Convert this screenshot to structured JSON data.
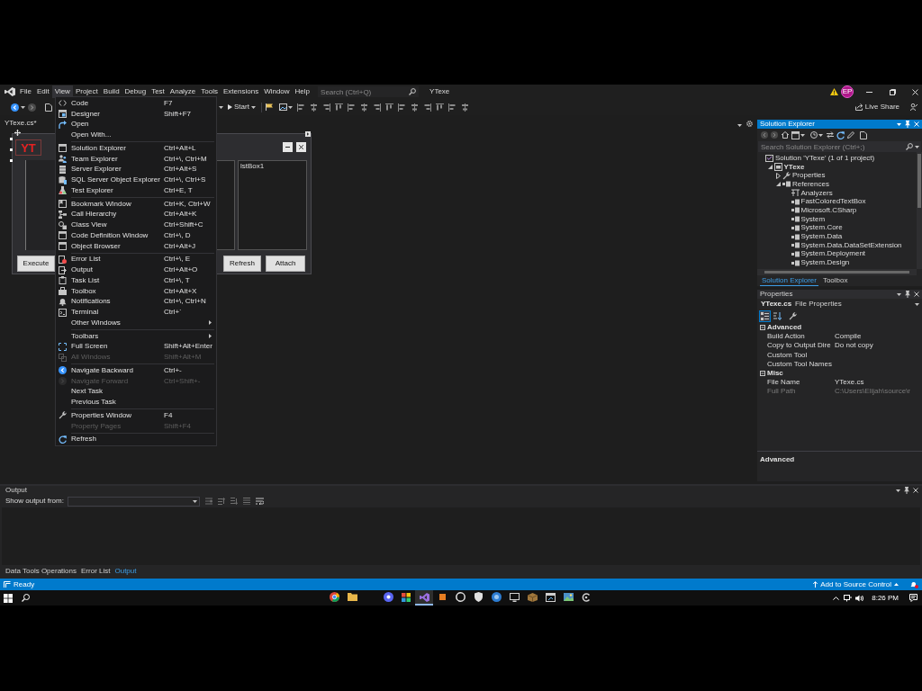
{
  "menubar": {
    "items": [
      {
        "label": "File",
        "selected": false
      },
      {
        "label": "Edit",
        "selected": false
      },
      {
        "label": "View",
        "selected": true
      },
      {
        "label": "Project",
        "selected": false
      },
      {
        "label": "Build",
        "selected": false
      },
      {
        "label": "Debug",
        "selected": false
      },
      {
        "label": "Test",
        "selected": false
      },
      {
        "label": "Analyze",
        "selected": false
      },
      {
        "label": "Tools",
        "selected": false
      },
      {
        "label": "Extensions",
        "selected": false
      },
      {
        "label": "Window",
        "selected": false
      },
      {
        "label": "Help",
        "selected": false
      }
    ],
    "search": {
      "placeholder": "Search (Ctrl+Q)"
    },
    "title": "YTexe",
    "account": "EP"
  },
  "toolbar": {
    "start": "Start",
    "live_share": "Live Share"
  },
  "document_tab": {
    "label": "YTexe.cs*"
  },
  "form_designer": {
    "logo": "YT",
    "listbox": "lstBox1",
    "buttons": [
      "Execute",
      "Refresh",
      "Attach"
    ]
  },
  "view_menu": {
    "groups": [
      [
        {
          "label": "Code",
          "shortcut": "F7",
          "disabled": false
        },
        {
          "label": "Designer",
          "shortcut": "Shift+F7",
          "disabled": false
        },
        {
          "label": "Open",
          "disabled": false
        },
        {
          "label": "Open With...",
          "disabled": false
        }
      ],
      [
        {
          "label": "Solution Explorer",
          "shortcut": "Ctrl+Alt+L",
          "disabled": false
        },
        {
          "label": "Team Explorer",
          "shortcut": "Ctrl+\\, Ctrl+M",
          "disabled": false
        },
        {
          "label": "Server Explorer",
          "shortcut": "Ctrl+Alt+S",
          "disabled": false
        },
        {
          "label": "SQL Server Object Explorer",
          "shortcut": "Ctrl+\\, Ctrl+S",
          "disabled": false
        },
        {
          "label": "Test Explorer",
          "shortcut": "Ctrl+E, T",
          "disabled": false
        }
      ],
      [
        {
          "label": "Bookmark Window",
          "shortcut": "Ctrl+K, Ctrl+W",
          "disabled": false
        },
        {
          "label": "Call Hierarchy",
          "shortcut": "Ctrl+Alt+K",
          "disabled": false
        },
        {
          "label": "Class View",
          "shortcut": "Ctrl+Shift+C",
          "disabled": false
        },
        {
          "label": "Code Definition Window",
          "shortcut": "Ctrl+\\, D",
          "disabled": false
        },
        {
          "label": "Object Browser",
          "shortcut": "Ctrl+Alt+J",
          "disabled": false
        }
      ],
      [
        {
          "label": "Error List",
          "shortcut": "Ctrl+\\, E",
          "disabled": false
        },
        {
          "label": "Output",
          "shortcut": "Ctrl+Alt+O",
          "disabled": false
        },
        {
          "label": "Task List",
          "shortcut": "Ctrl+\\, T",
          "disabled": false
        },
        {
          "label": "Toolbox",
          "shortcut": "Ctrl+Alt+X",
          "disabled": false
        },
        {
          "label": "Notifications",
          "shortcut": "Ctrl+\\, Ctrl+N",
          "disabled": false
        },
        {
          "label": "Terminal",
          "shortcut": "Ctrl+`",
          "disabled": false
        },
        {
          "label": "Other Windows",
          "submenu": true,
          "disabled": false
        }
      ],
      [
        {
          "label": "Toolbars",
          "submenu": true,
          "disabled": false
        },
        {
          "label": "Full Screen",
          "shortcut": "Shift+Alt+Enter",
          "disabled": false
        },
        {
          "label": "All Windows",
          "shortcut": "Shift+Alt+M",
          "disabled": true
        }
      ],
      [
        {
          "label": "Navigate Backward",
          "shortcut": "Ctrl+-",
          "disabled": false
        },
        {
          "label": "Navigate Forward",
          "shortcut": "Ctrl+Shift+-",
          "disabled": true
        },
        {
          "label": "Next Task",
          "disabled": false
        },
        {
          "label": "Previous Task",
          "disabled": false
        }
      ],
      [
        {
          "label": "Properties Window",
          "shortcut": "F4",
          "disabled": false
        },
        {
          "label": "Property Pages",
          "shortcut": "Shift+F4",
          "disabled": true
        }
      ],
      [
        {
          "label": "Refresh",
          "disabled": false
        }
      ]
    ]
  },
  "solution_explorer": {
    "title": "Solution Explorer",
    "search": {
      "placeholder": "Search Solution Explorer (Ctrl+;)"
    },
    "tree": [
      {
        "label": "Solution 'YTexe' (1 of 1 project)",
        "kind": "solution",
        "children": [
          {
            "label": "YTexe",
            "kind": "project",
            "expanded": true,
            "children": [
              {
                "label": "Properties",
                "kind": "properties",
                "expanded": false
              },
              {
                "label": "References",
                "kind": "references",
                "expanded": true,
                "children": [
                  {
                    "label": "Analyzers",
                    "kind": "analyzers"
                  },
                  {
                    "label": "FastColoredTextBox",
                    "kind": "reference"
                  },
                  {
                    "label": "Microsoft.CSharp",
                    "kind": "reference"
                  },
                  {
                    "label": "System",
                    "kind": "reference"
                  },
                  {
                    "label": "System.Core",
                    "kind": "reference"
                  },
                  {
                    "label": "System.Data",
                    "kind": "reference"
                  },
                  {
                    "label": "System.Data.DataSetExtension",
                    "kind": "reference"
                  },
                  {
                    "label": "System.Deployment",
                    "kind": "reference"
                  },
                  {
                    "label": "System.Design",
                    "kind": "reference"
                  }
                ]
              }
            ]
          }
        ]
      }
    ],
    "tabs": [
      {
        "label": "Solution Explorer",
        "selected": true
      },
      {
        "label": "Toolbox",
        "selected": false
      }
    ]
  },
  "properties": {
    "title": "Properties",
    "object": "YTexe.cs",
    "object_type": "File Properties",
    "sort_buttons": [
      {
        "selected": true
      },
      {
        "selected": false
      }
    ],
    "categories": [
      {
        "name": "Advanced",
        "expanded": true,
        "rows": [
          {
            "name": "Build Action",
            "value": "Compile",
            "readonly": false
          },
          {
            "name": "Copy to Output Dire",
            "value": "Do not copy",
            "readonly": false
          },
          {
            "name": "Custom Tool",
            "readonly": false
          },
          {
            "name": "Custom Tool Names",
            "readonly": false
          }
        ]
      },
      {
        "name": "Misc",
        "expanded": true,
        "rows": [
          {
            "name": "File Name",
            "value": "YTexe.cs",
            "readonly": false
          },
          {
            "name": "Full Path",
            "value": "C:\\Users\\Elijah\\source\\r",
            "readonly": true
          }
        ]
      }
    ],
    "description": "Advanced"
  },
  "output": {
    "title": "Output",
    "source_label": "Show output from:",
    "tabs": [
      {
        "label": "Data Tools Operations",
        "selected": false
      },
      {
        "label": "Error List",
        "selected": false
      },
      {
        "label": "Output",
        "selected": true
      }
    ]
  },
  "status_bar": {
    "text": "Ready",
    "source_control": "Add to Source Control"
  },
  "taskbar": {
    "apps": [
      {
        "selected": false
      },
      {
        "selected": false
      },
      {
        "selected": false
      },
      {
        "selected": false
      },
      {
        "selected": true
      },
      {
        "selected": false
      },
      {
        "selected": false
      },
      {
        "selected": false
      },
      {
        "selected": false
      },
      {
        "selected": false
      },
      {
        "selected": false
      },
      {
        "selected": false
      },
      {
        "selected": false
      },
      {
        "selected": false
      }
    ],
    "clock": "8:26 PM"
  }
}
